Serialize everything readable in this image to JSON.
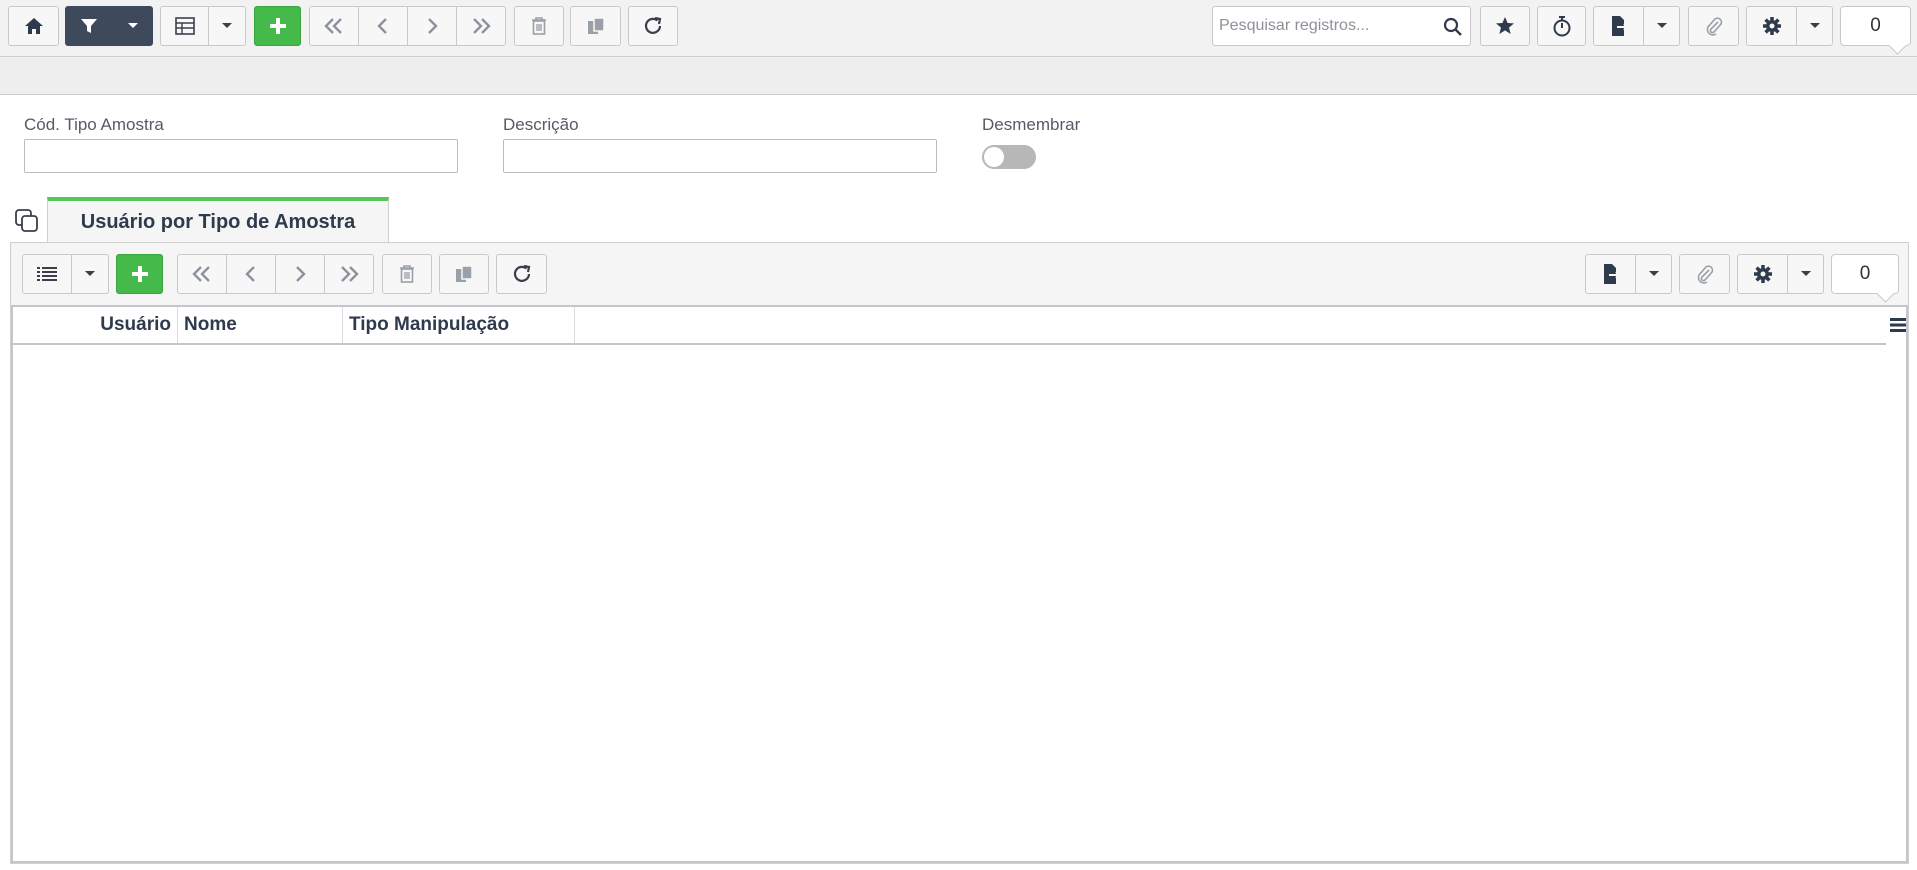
{
  "toolbar": {
    "search_placeholder": "Pesquisar registros...",
    "record_count": "0"
  },
  "form": {
    "cod_label": "Cód. Tipo Amostra",
    "cod_value": "",
    "descricao_label": "Descrição",
    "descricao_value": "",
    "desmembrar_label": "Desmembrar",
    "desmembrar_on": false
  },
  "tab": {
    "label": "Usuário por Tipo de Amostra"
  },
  "grid": {
    "record_count": "0",
    "columns": [
      "Usuário",
      "Nome",
      "Tipo Manipulação"
    ],
    "rows": []
  },
  "colors": {
    "accent_green": "#45b94a",
    "filter_active": "#3e4a5c",
    "tab_indicator": "#55c65a"
  },
  "icons": {
    "top": [
      "home-icon",
      "filter-icon",
      "chevron-down-icon",
      "table-icon",
      "chevron-down-icon",
      "plus-icon",
      "first-record-icon",
      "prev-record-icon",
      "next-record-icon",
      "last-record-icon",
      "trash-icon",
      "copy-icon",
      "refresh-icon",
      "search-icon",
      "star-icon",
      "timer-icon",
      "export-icon",
      "chevron-down-icon",
      "attach-icon",
      "gear-icon",
      "chevron-down-icon"
    ],
    "grid": [
      "list-icon",
      "chevron-down-icon",
      "plus-icon",
      "first-record-icon",
      "prev-record-icon",
      "next-record-icon",
      "last-record-icon",
      "trash-icon",
      "copy-icon",
      "refresh-icon",
      "export-icon",
      "chevron-down-icon",
      "attach-icon",
      "gear-icon",
      "chevron-down-icon",
      "column-menu-icon"
    ]
  }
}
